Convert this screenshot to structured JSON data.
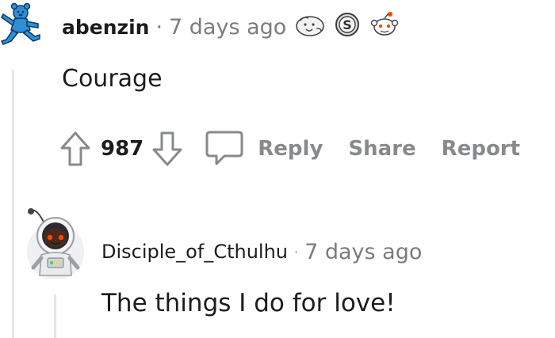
{
  "comments": [
    {
      "username": "abenzin",
      "separator": "·",
      "time": "7 days ago",
      "body": "Courage",
      "score": "987",
      "avatar_icon": "dancing-bear-avatar-icon",
      "awards": [
        "wholesome-seal-award-icon",
        "silver-award-icon",
        "snoo-award-icon"
      ],
      "actions": {
        "reply": "Reply",
        "share": "Share",
        "report": "Report"
      }
    },
    {
      "username": "Disciple_of_Cthulhu",
      "separator": "·",
      "time": "7 days ago",
      "body": "The things I do for love!",
      "avatar_icon": "astronaut-snoo-avatar-icon"
    }
  ],
  "colors": {
    "text": "#1c1c1c",
    "meta": "#7c7c7c",
    "action": "#878a8c",
    "thread_line": "#e5e6e7",
    "bear_blue": "#2f8fd6"
  }
}
